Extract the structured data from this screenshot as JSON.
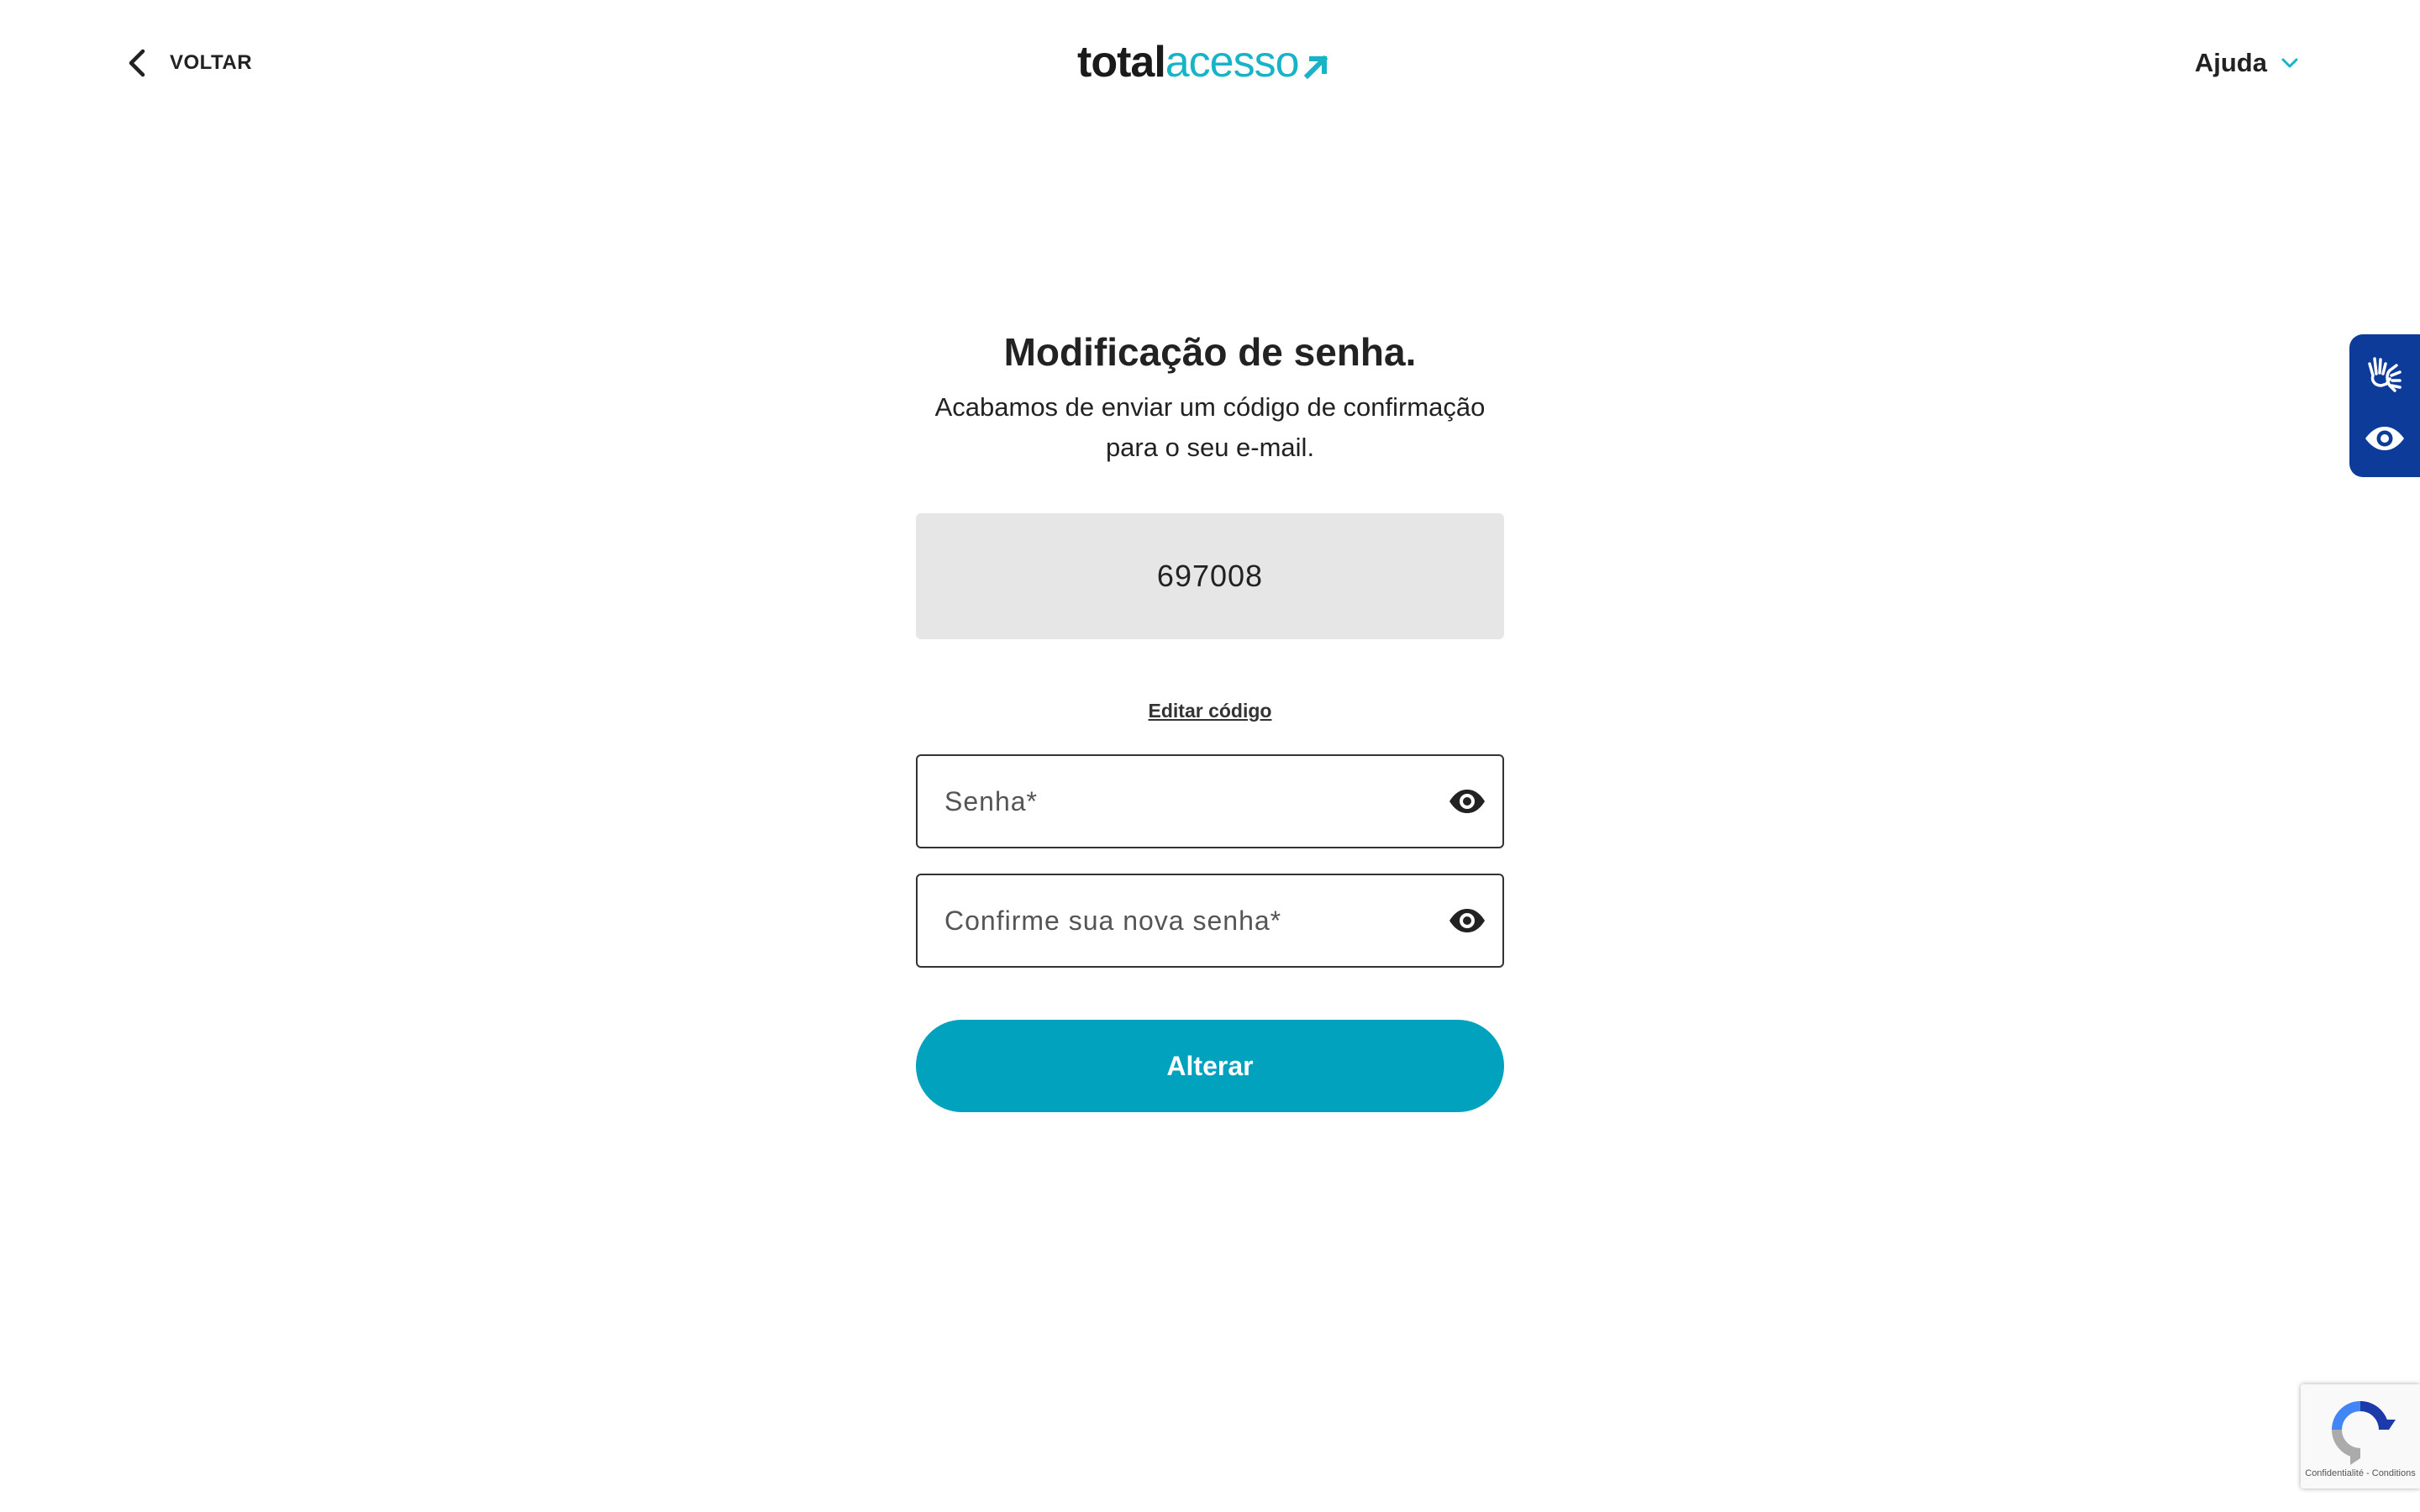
{
  "header": {
    "back_label": "VOLTAR",
    "logo_part1": "total",
    "logo_part2": "acesso",
    "help_label": "Ajuda"
  },
  "form": {
    "title": "Modificação de senha.",
    "subtitle_line1": "Acabamos de enviar um código de confirmação",
    "subtitle_line2": "para o seu e-mail.",
    "code_value": "697008",
    "edit_code_label": "Editar código",
    "password_placeholder": "Senha*",
    "confirm_password_placeholder": "Confirme sua nova senha*",
    "submit_label": "Alterar"
  },
  "recaptcha": {
    "privacy_label": "Confidentialité",
    "separator": " - ",
    "terms_label": "Conditions"
  },
  "colors": {
    "brand_teal": "#00a2bd",
    "logo_accent": "#17b4c8",
    "a11y_blue": "#0d3b99",
    "code_box_bg": "#e6e6e6"
  },
  "icons": {
    "back": "chevron-left-icon",
    "help": "chevron-down-icon",
    "show_password": "eye-icon",
    "sign_language": "hands-icon",
    "visual_accessibility": "eye-icon",
    "recaptcha": "recaptcha-logo-icon"
  }
}
